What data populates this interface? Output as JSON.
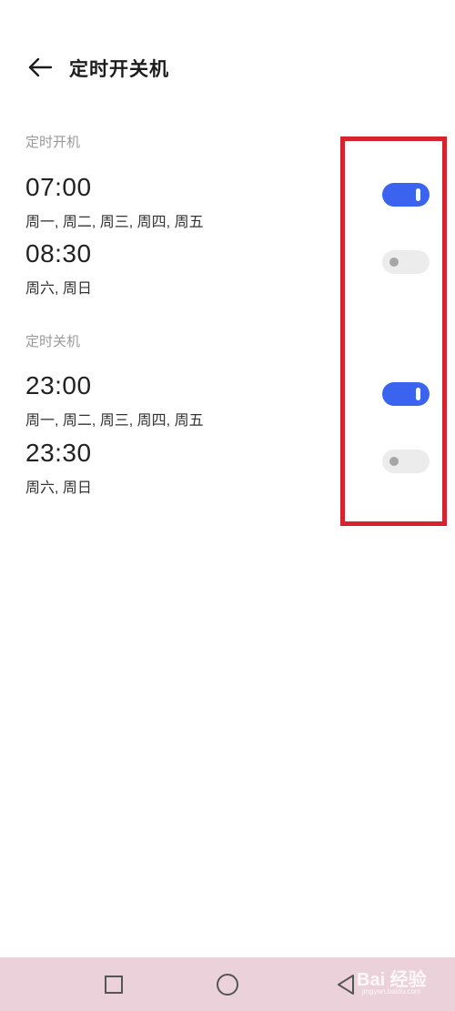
{
  "header": {
    "title": "定时开关机",
    "back_icon": "arrow-left-icon"
  },
  "sections": {
    "power_on": {
      "label": "定时开机",
      "items": [
        {
          "time": "07:00",
          "days": "周一, 周二, 周三, 周四, 周五",
          "enabled": true
        },
        {
          "time": "08:30",
          "days": "周六, 周日",
          "enabled": false
        }
      ]
    },
    "power_off": {
      "label": "定时关机",
      "items": [
        {
          "time": "23:00",
          "days": "周一, 周二, 周三, 周四, 周五",
          "enabled": true
        },
        {
          "time": "23:30",
          "days": "周六, 周日",
          "enabled": false
        }
      ]
    }
  },
  "colors": {
    "toggle_on": "#3a63f0",
    "toggle_off": "#ececec",
    "highlight": "#d7232e",
    "nav_bar": "#ebd1d9"
  },
  "nav": {
    "recent_icon": "square-icon",
    "home_icon": "circle-icon",
    "back_icon": "triangle-back-icon"
  },
  "watermark": {
    "text": "Bai 经验",
    "subtext": "jingyan.baidu.com"
  }
}
